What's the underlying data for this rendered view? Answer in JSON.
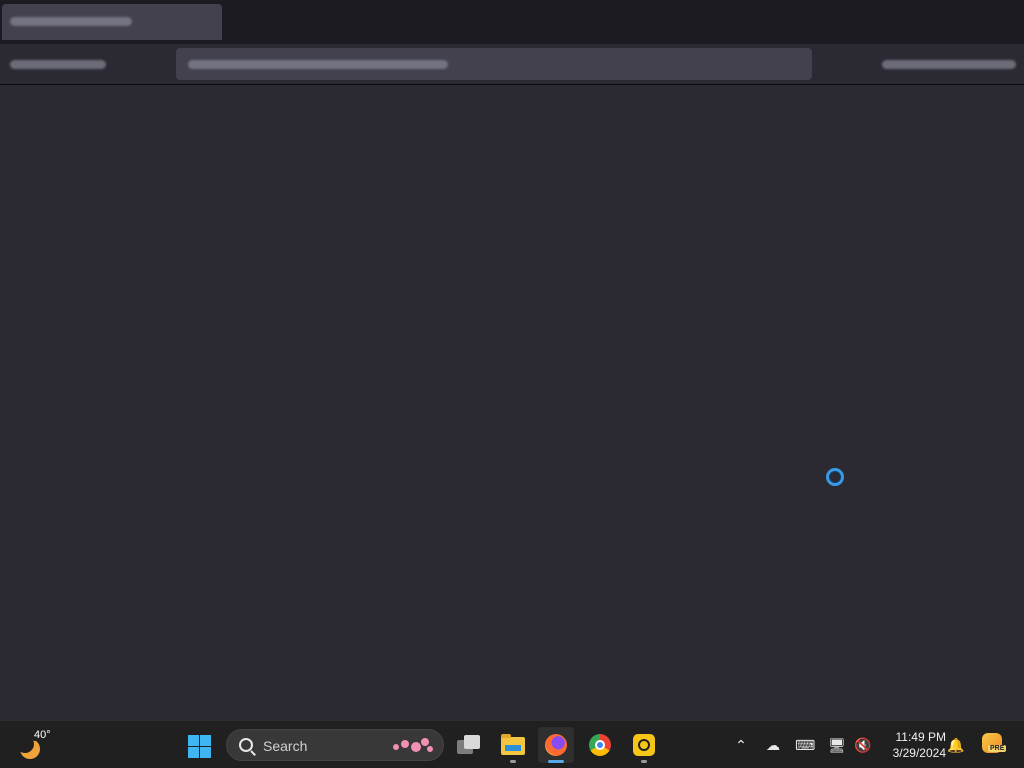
{
  "taskbar": {
    "weather": {
      "temperature": "40°",
      "icon": "moon-weather-icon"
    },
    "search": {
      "label": "Search"
    },
    "apps": [
      {
        "name": "task-view",
        "icon": "task-view-icon"
      },
      {
        "name": "file-explorer",
        "icon": "folder-icon"
      },
      {
        "name": "firefox",
        "icon": "firefox-icon",
        "active": true
      },
      {
        "name": "chrome",
        "icon": "chrome-icon"
      },
      {
        "name": "remote-desktop",
        "icon": "remote-desktop-icon"
      }
    ],
    "tray": {
      "time": "11:49 PM",
      "date": "3/29/2024",
      "copilot_badge": "PRE"
    }
  },
  "colors": {
    "accent": "#3fb6f2",
    "busy_cursor": "#3a9ae6",
    "page_background": "#2b2a33",
    "taskbar": "#202020"
  }
}
